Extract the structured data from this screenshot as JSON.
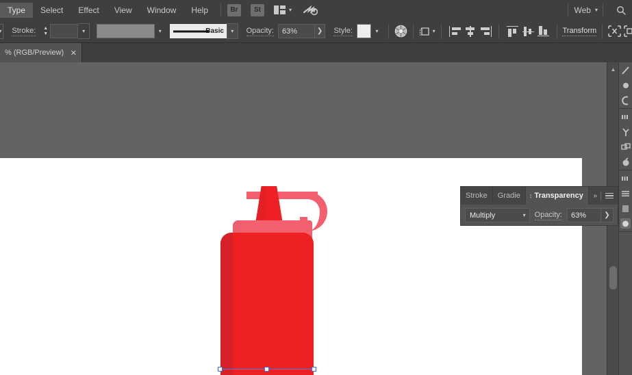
{
  "menubar": {
    "items": [
      {
        "label": "Type",
        "active": true
      },
      {
        "label": "Select",
        "active": false
      },
      {
        "label": "Effect",
        "active": false
      },
      {
        "label": "View",
        "active": false
      },
      {
        "label": "Window",
        "active": false
      },
      {
        "label": "Help",
        "active": false
      }
    ],
    "bridge_label": "Br",
    "stock_label": "St",
    "workspace_label": "Web",
    "arrange_icon": "arrange-documents-icon",
    "cloud_icon": "cloud-sync-icon",
    "search_icon": "search-icon",
    "chevron_icon": "chevron-down-icon"
  },
  "control_bar": {
    "stroke_label": "Stroke:",
    "stroke_weight_value": "",
    "stroke_color_swatch": "#8a8a8a",
    "profile_label": "Basic",
    "opacity_label": "Opacity:",
    "opacity_value": "63%",
    "style_label": "Style:",
    "style_swatch": "#ededed",
    "transform_label": "Transform",
    "recolor_icon": "recolor-artwork-icon",
    "perspective_icon": "perspective-grid-icon",
    "align_icons": [
      "align-left-icon",
      "align-horizontal-center-icon",
      "align-right-icon",
      "align-top-icon",
      "align-vertical-center-icon",
      "align-bottom-icon"
    ],
    "shape_builder_icon": "shape-builder-icon",
    "isolate_icon": "isolate-selected-icon"
  },
  "document_tab": {
    "title": "% (RGB/Preview)",
    "close_label": "✕"
  },
  "canvas": {
    "artboard_background": "#ffffff",
    "canvas_background": "#636363",
    "artwork_name": "red-squeeze-bottle",
    "colors": {
      "body_red": "#ED2024",
      "body_shade": "#D6202A",
      "cap_salmon": "#F4606D",
      "cap_shade": "#E9606E",
      "selection_blue": "#4a7fe8"
    }
  },
  "scrollbar": {
    "up_arrow_icon": "scroll-up-arrow-icon",
    "thumb_name": "vertical-scroll-thumb"
  },
  "right_dock": {
    "groups": [
      {
        "icons": [
          "brushes-icon",
          "symbols-icon",
          "appearance-icon"
        ]
      },
      {
        "icons": [
          "layers-icon",
          "artboards-icon",
          "pathfinder-icon",
          "color-guide-icon"
        ]
      },
      {
        "icons": [
          "align-panel-icon",
          "swatches-icon",
          "color-panel-icon"
        ]
      }
    ]
  },
  "transparency_panel": {
    "tabs": [
      {
        "label": "Stroke",
        "active": false
      },
      {
        "label": "Gradie",
        "active": false
      },
      {
        "label": "Transparency",
        "active": true
      }
    ],
    "blend_mode": "Multiply",
    "opacity_label": "Opacity:",
    "opacity_value": "63%",
    "expand_icon": "expand-panel-icon",
    "menu_icon": "panel-menu-icon",
    "grip_icon": "panel-grip-icon"
  }
}
